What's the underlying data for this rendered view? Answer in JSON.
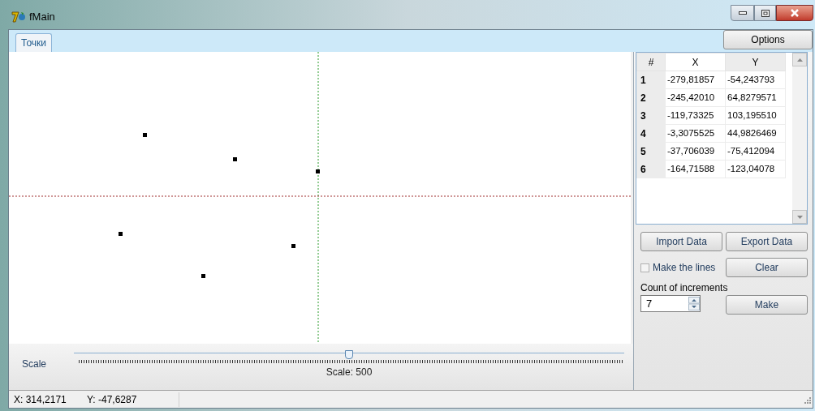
{
  "window": {
    "title": "fMain"
  },
  "tabs": [
    {
      "label": "Точки",
      "selected": true
    }
  ],
  "options_button": "Options",
  "scale": {
    "label": "Scale",
    "level": 0.5,
    "reading": "Scale: 500"
  },
  "table": {
    "columns": [
      "#",
      "X",
      "Y"
    ],
    "rows": [
      [
        "1",
        "-279,81857",
        "-54,243793"
      ],
      [
        "2",
        "-245,42010",
        "64,8279571"
      ],
      [
        "3",
        "-119,73325",
        "103,195510"
      ],
      [
        "4",
        "-3,3075525",
        "44,9826469"
      ],
      [
        "5",
        "-37,706039",
        "-75,412094"
      ],
      [
        "6",
        "-164,71588",
        "-123,04078"
      ]
    ]
  },
  "buttons": {
    "import": "Import Data",
    "export": "Export Data",
    "clear": "Clear",
    "make": "Make"
  },
  "make_lines": {
    "label": "Make the lines",
    "checked": false
  },
  "increments": {
    "label": "Count of increments",
    "value": "7"
  },
  "status_bar": [
    "X: 314,2171",
    "Y: -47,6287"
  ]
}
